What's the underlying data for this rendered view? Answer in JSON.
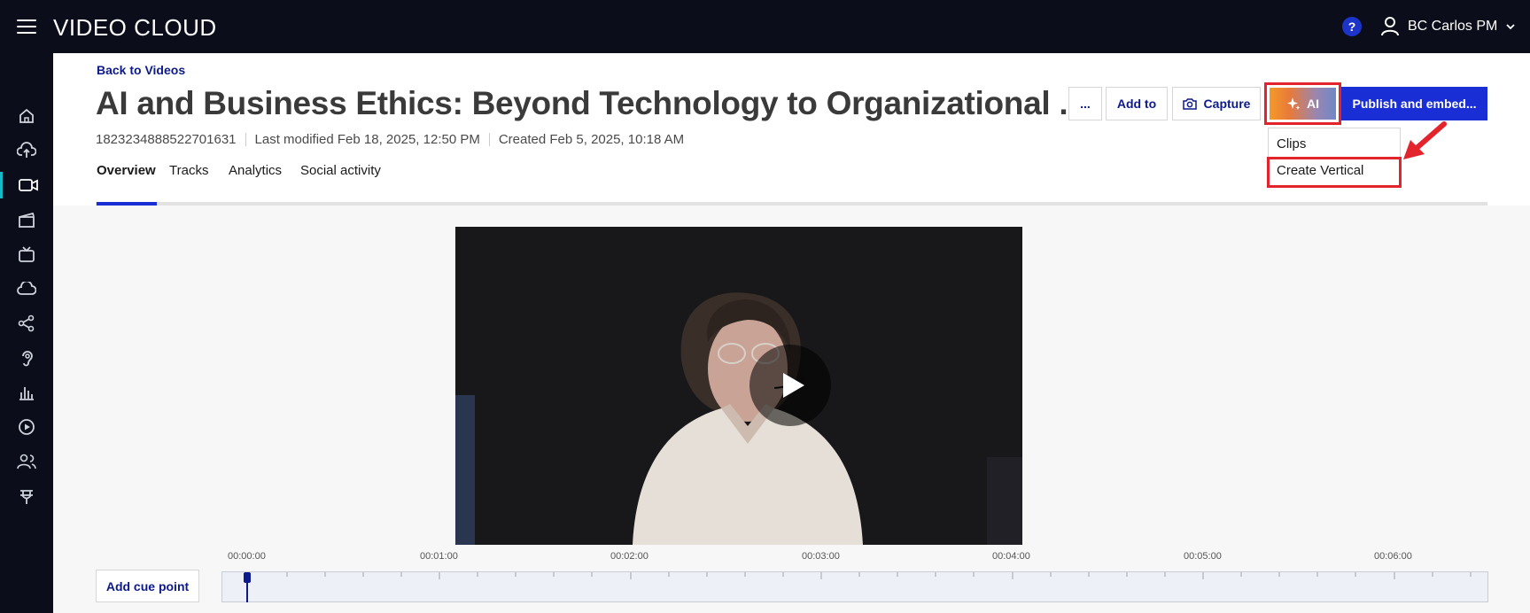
{
  "header": {
    "brand": "VIDEO CLOUD",
    "help_label": "?",
    "user_name": "BC Carlos PM"
  },
  "sidebar": {
    "icons": [
      "home-icon",
      "upload-icon",
      "video-icon",
      "clapperboard-icon",
      "tv-icon",
      "cloud-icon",
      "share-icon",
      "ear-icon",
      "bar-chart-icon",
      "play-circle-icon",
      "users-icon",
      "plug-icon"
    ],
    "active_index": 2
  },
  "page": {
    "back_label": "Back to Videos",
    "title": "AI and Business Ethics: Beyond Technology to Organizational ...",
    "video_id": "1823234888522701631",
    "last_modified": "Last modified Feb 18, 2025, 12:50 PM",
    "created": "Created Feb 5, 2025, 10:18 AM"
  },
  "actions": {
    "more_label": "...",
    "add_to_label": "Add to",
    "capture_label": "Capture",
    "ai_label": "AI",
    "publish_label": "Publish and embed..."
  },
  "ai_menu": {
    "items": [
      "Clips",
      "Create Vertical"
    ]
  },
  "tabs": [
    "Overview",
    "Tracks",
    "Analytics",
    "Social activity"
  ],
  "active_tab": "Overview",
  "timeline": {
    "labels": [
      "00:00:00",
      "00:01:00",
      "00:02:00",
      "00:03:00",
      "00:04:00",
      "00:05:00",
      "00:06:00"
    ],
    "cue_button_label": "Add cue point",
    "playhead_time": "00:00:00"
  },
  "colors": {
    "topbar": "#0b0e1a",
    "primary": "#1a2ed6",
    "link": "#0d1a8c",
    "highlight": "#e4242c",
    "active_sidebar": "#18b8c9"
  }
}
